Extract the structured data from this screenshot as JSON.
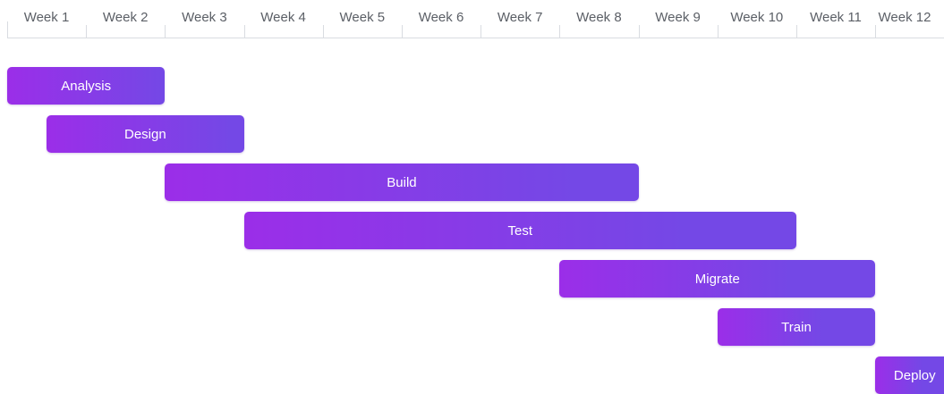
{
  "chart_data": {
    "type": "gantt",
    "title": "",
    "xlabel": "",
    "ylabel": "",
    "grid": false,
    "weeks": [
      "Week 1",
      "Week 2",
      "Week 3",
      "Week 4",
      "Week 5",
      "Week 6",
      "Week 7",
      "Week 8",
      "Week 9",
      "Week 10",
      "Week 11",
      "Week 12"
    ],
    "tasks": [
      {
        "name": "Analysis",
        "start_week": 1.0,
        "end_week": 3.0
      },
      {
        "name": "Design",
        "start_week": 1.5,
        "end_week": 4.0
      },
      {
        "name": "Build",
        "start_week": 3.0,
        "end_week": 9.0
      },
      {
        "name": "Test",
        "start_week": 4.0,
        "end_week": 11.0
      },
      {
        "name": "Migrate",
        "start_week": 8.0,
        "end_week": 12.0
      },
      {
        "name": "Train",
        "start_week": 10.0,
        "end_week": 12.0
      },
      {
        "name": "Deploy",
        "start_week": 12.0,
        "end_week": 13.0
      }
    ],
    "colors": {
      "bar_start": "#9b2ee8",
      "bar_end": "#7448e6",
      "text": "#ffffff",
      "grid": "#d9dce1",
      "label": "#5b5f66"
    }
  }
}
